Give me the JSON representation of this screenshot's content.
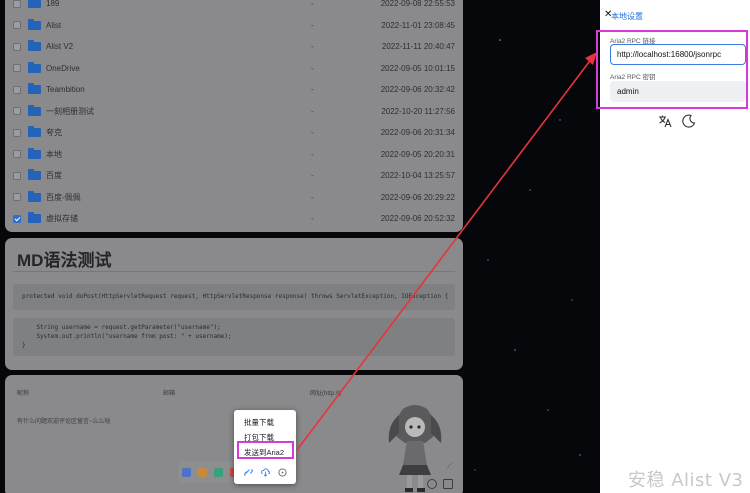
{
  "files": [
    {
      "name": "189",
      "size": "-",
      "date": "2022-09-08 22:55:53",
      "checked": false
    },
    {
      "name": "Alist",
      "size": "-",
      "date": "2022-11-01 23:08:45",
      "checked": false
    },
    {
      "name": "Alist V2",
      "size": "-",
      "date": "2022-11-11 20:40:47",
      "checked": false
    },
    {
      "name": "OneDrive",
      "size": "-",
      "date": "2022-09-05 10:01:15",
      "checked": false
    },
    {
      "name": "Teambition",
      "size": "-",
      "date": "2022-09-06 20:32:42",
      "checked": false
    },
    {
      "name": "一刻相册测试",
      "size": "-",
      "date": "2022-10-20 11:27:56",
      "checked": false
    },
    {
      "name": "夸克",
      "size": "-",
      "date": "2022-09-06 20:31:34",
      "checked": false
    },
    {
      "name": "本地",
      "size": "-",
      "date": "2022-09-05 20:20:31",
      "checked": false
    },
    {
      "name": "百度",
      "size": "-",
      "date": "2022-10-04 13:25:57",
      "checked": false
    },
    {
      "name": "百度-佩佩",
      "size": "-",
      "date": "2022-09-06 20:29:22",
      "checked": false
    },
    {
      "name": "虚拟存储",
      "size": "-",
      "date": "2022-09-06 20:52:32",
      "checked": true
    }
  ],
  "markdown": {
    "title": "MD语法测试",
    "code_line1": "protected void doPost(HttpServletRequest request, HttpServletResponse response) throws ServletException, IOException {",
    "code_line2": "    String username = request.getParameter(\"username\");",
    "code_line3": "    System.out.println(\"username from post: \" + username);",
    "code_line4": "}"
  },
  "comments": {
    "nickname_placeholder": "昵称",
    "email_placeholder": "邮箱",
    "url_placeholder": "网址(http://)",
    "text": "有什么问题欢迎评论区留言~么么哒"
  },
  "context_menu": {
    "batch_download": "批量下载",
    "pack_download": "打包下载",
    "send_aria2": "发送到Aria2"
  },
  "drawer": {
    "close": "✕",
    "title": "本地设置",
    "rpc_url_label": "Aria2 RPC 链接",
    "rpc_url_value": "http://localhost:16800/jsonrpc",
    "rpc_secret_label": "Aria2 RPC 密钥",
    "rpc_secret_value": "admin"
  },
  "watermark": "安稳 Alist V3",
  "colors": {
    "accent": "#1f6fe0",
    "highlight": "#d43bd7",
    "arrow": "#e8333a",
    "folder": "#2463b8"
  }
}
